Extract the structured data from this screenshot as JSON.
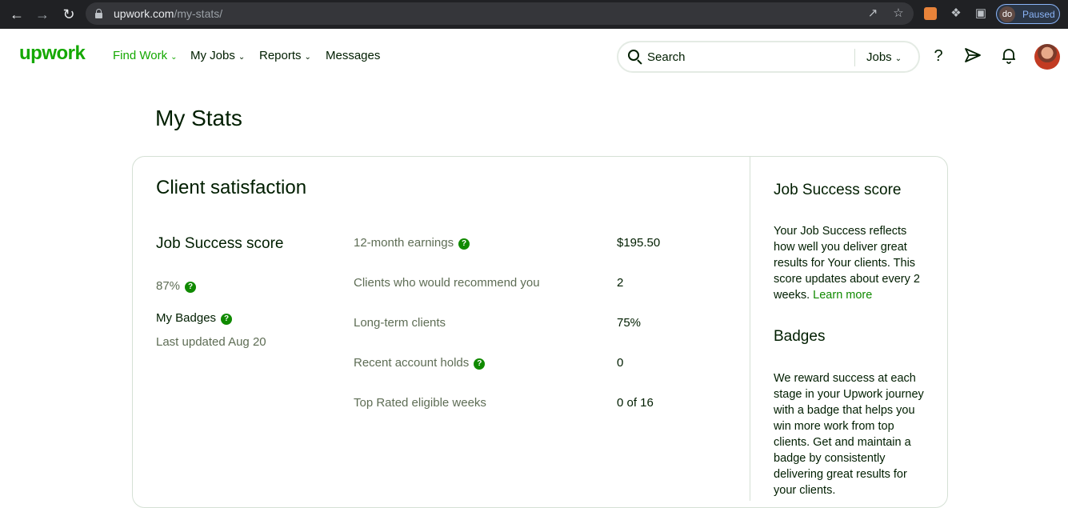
{
  "browser": {
    "url_domain": "upwork.com",
    "url_path": "/my-stats/",
    "profile_initials": "do",
    "profile_status": "Paused"
  },
  "nav": {
    "logo": "upwork",
    "links": [
      "Find Work",
      "My Jobs",
      "Reports",
      "Messages"
    ],
    "search_placeholder": "Search",
    "search_category": "Jobs"
  },
  "page": {
    "title": "My Stats"
  },
  "client_satisfaction": {
    "title": "Client satisfaction",
    "jss_title": "Job Success score",
    "jss_value": "87%",
    "badges_title": "My Badges",
    "badges_updated": "Last updated Aug 20",
    "stats": [
      {
        "label": "12-month earnings",
        "value": "$195.50",
        "help": true
      },
      {
        "label": "Clients who would recommend you",
        "value": "2",
        "help": false
      },
      {
        "label": "Long-term clients",
        "value": "75%",
        "help": false
      },
      {
        "label": "Recent account holds",
        "value": "0",
        "help": true
      },
      {
        "label": "Top Rated eligible weeks",
        "value": "0 of 16",
        "help": false
      }
    ]
  },
  "sidebar": {
    "jss_heading": "Job Success score",
    "jss_text": "Your Job Success reflects how well you deliver great results for Your clients. This score updates about every 2 weeks.",
    "jss_link": "Learn more",
    "badges_heading": "Badges",
    "badges_text": "We reward success at each stage in your Upwork journey with a badge that helps you win more work from top clients. Get and maintain a badge by consistently delivering great results for your clients."
  },
  "colors": {
    "brand_green": "#14a800",
    "link_green": "#108a00",
    "text_dark": "#001e00",
    "text_muted": "#5e6d55",
    "border": "#d5e0d5"
  }
}
